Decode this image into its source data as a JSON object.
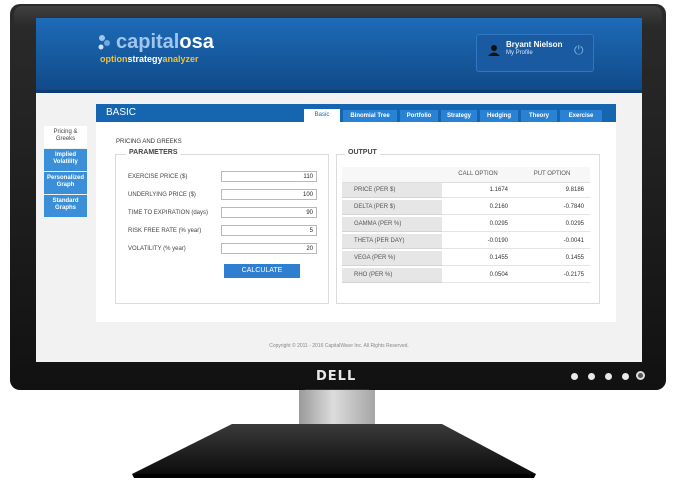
{
  "monitor": {
    "brand": "DELL"
  },
  "app": {
    "logo_name_accent": "capital",
    "logo_name_rest": "osa",
    "logo_sub_1": "option",
    "logo_sub_2": "strategy",
    "logo_sub_3": "analyzer",
    "user_name": "Bryant Nielson",
    "profile_link": "My Profile"
  },
  "sidebar": {
    "items": [
      {
        "line1": "Pricing &",
        "line2": "Greeks"
      },
      {
        "line1": "Implied",
        "line2": "Volatility"
      },
      {
        "line1": "Personalized",
        "line2": "Graph"
      },
      {
        "line1": "Standard",
        "line2": "Graphs"
      }
    ]
  },
  "panel": {
    "title": "BASIC",
    "tabs": [
      "Basic",
      "Binomial Tree",
      "Portfolio",
      "Strategy",
      "Hedging",
      "Theory",
      "Exercise"
    ],
    "section_label": "PRICING AND GREEKS"
  },
  "parameters": {
    "title": "PARAMETERS",
    "fields": [
      {
        "label": "EXERCISE PRICE ($)",
        "value": "110"
      },
      {
        "label": "UNDERLYING PRICE ($)",
        "value": "100"
      },
      {
        "label": "TIME TO EXPIRATION (days)",
        "value": "90"
      },
      {
        "label": "RISK FREE RATE (% year)",
        "value": "5"
      },
      {
        "label": "VOLATILITY (% year)",
        "value": "20"
      }
    ],
    "calculate_label": "CALCULATE"
  },
  "output": {
    "title": "OUTPUT",
    "col_call": "CALL OPTION",
    "col_put": "PUT OPTION",
    "rows": [
      {
        "label": "PRICE (PER $)",
        "call": "1.1674",
        "put": "9.8186"
      },
      {
        "label": "DELTA (PER $)",
        "call": "0.2160",
        "put": "-0.7840"
      },
      {
        "label": "GAMMA (PER %)",
        "call": "0.0295",
        "put": "0.0295"
      },
      {
        "label": "THETA (PER DAY)",
        "call": "-0.0190",
        "put": "-0.0041"
      },
      {
        "label": "VEGA (PER %)",
        "call": "0.1455",
        "put": "0.1455"
      },
      {
        "label": "RHO (PER %)",
        "call": "0.0504",
        "put": "-0.2175"
      }
    ]
  },
  "footer": {
    "text": "Copyright © 2011 - 2016 CapitalWave Inc. All Rights Reserved."
  }
}
